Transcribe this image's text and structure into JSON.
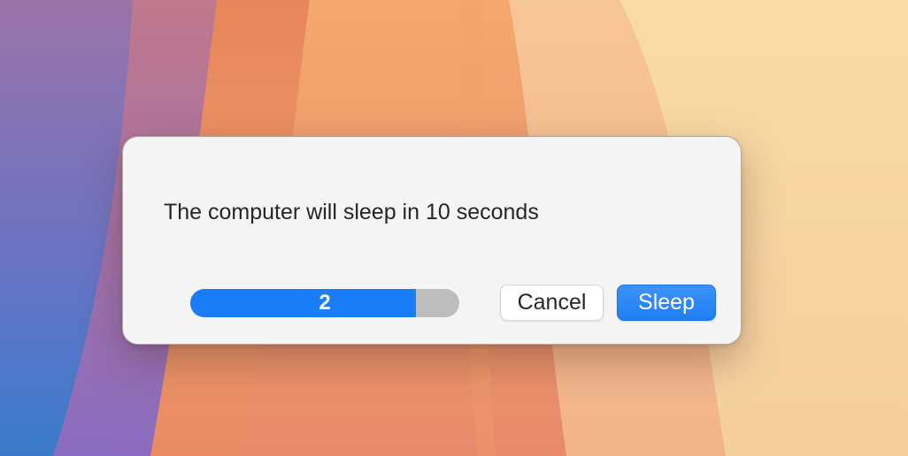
{
  "colors": {
    "accent": "#1a7cf6",
    "dialog_background": "#f5f5f5",
    "progress_track": "#bdbdbd"
  },
  "dialog": {
    "message": "The computer will sleep in 10 seconds",
    "progress": {
      "label": "2",
      "fraction": 0.84
    },
    "buttons": {
      "cancel_label": "Cancel",
      "sleep_label": "Sleep"
    }
  }
}
